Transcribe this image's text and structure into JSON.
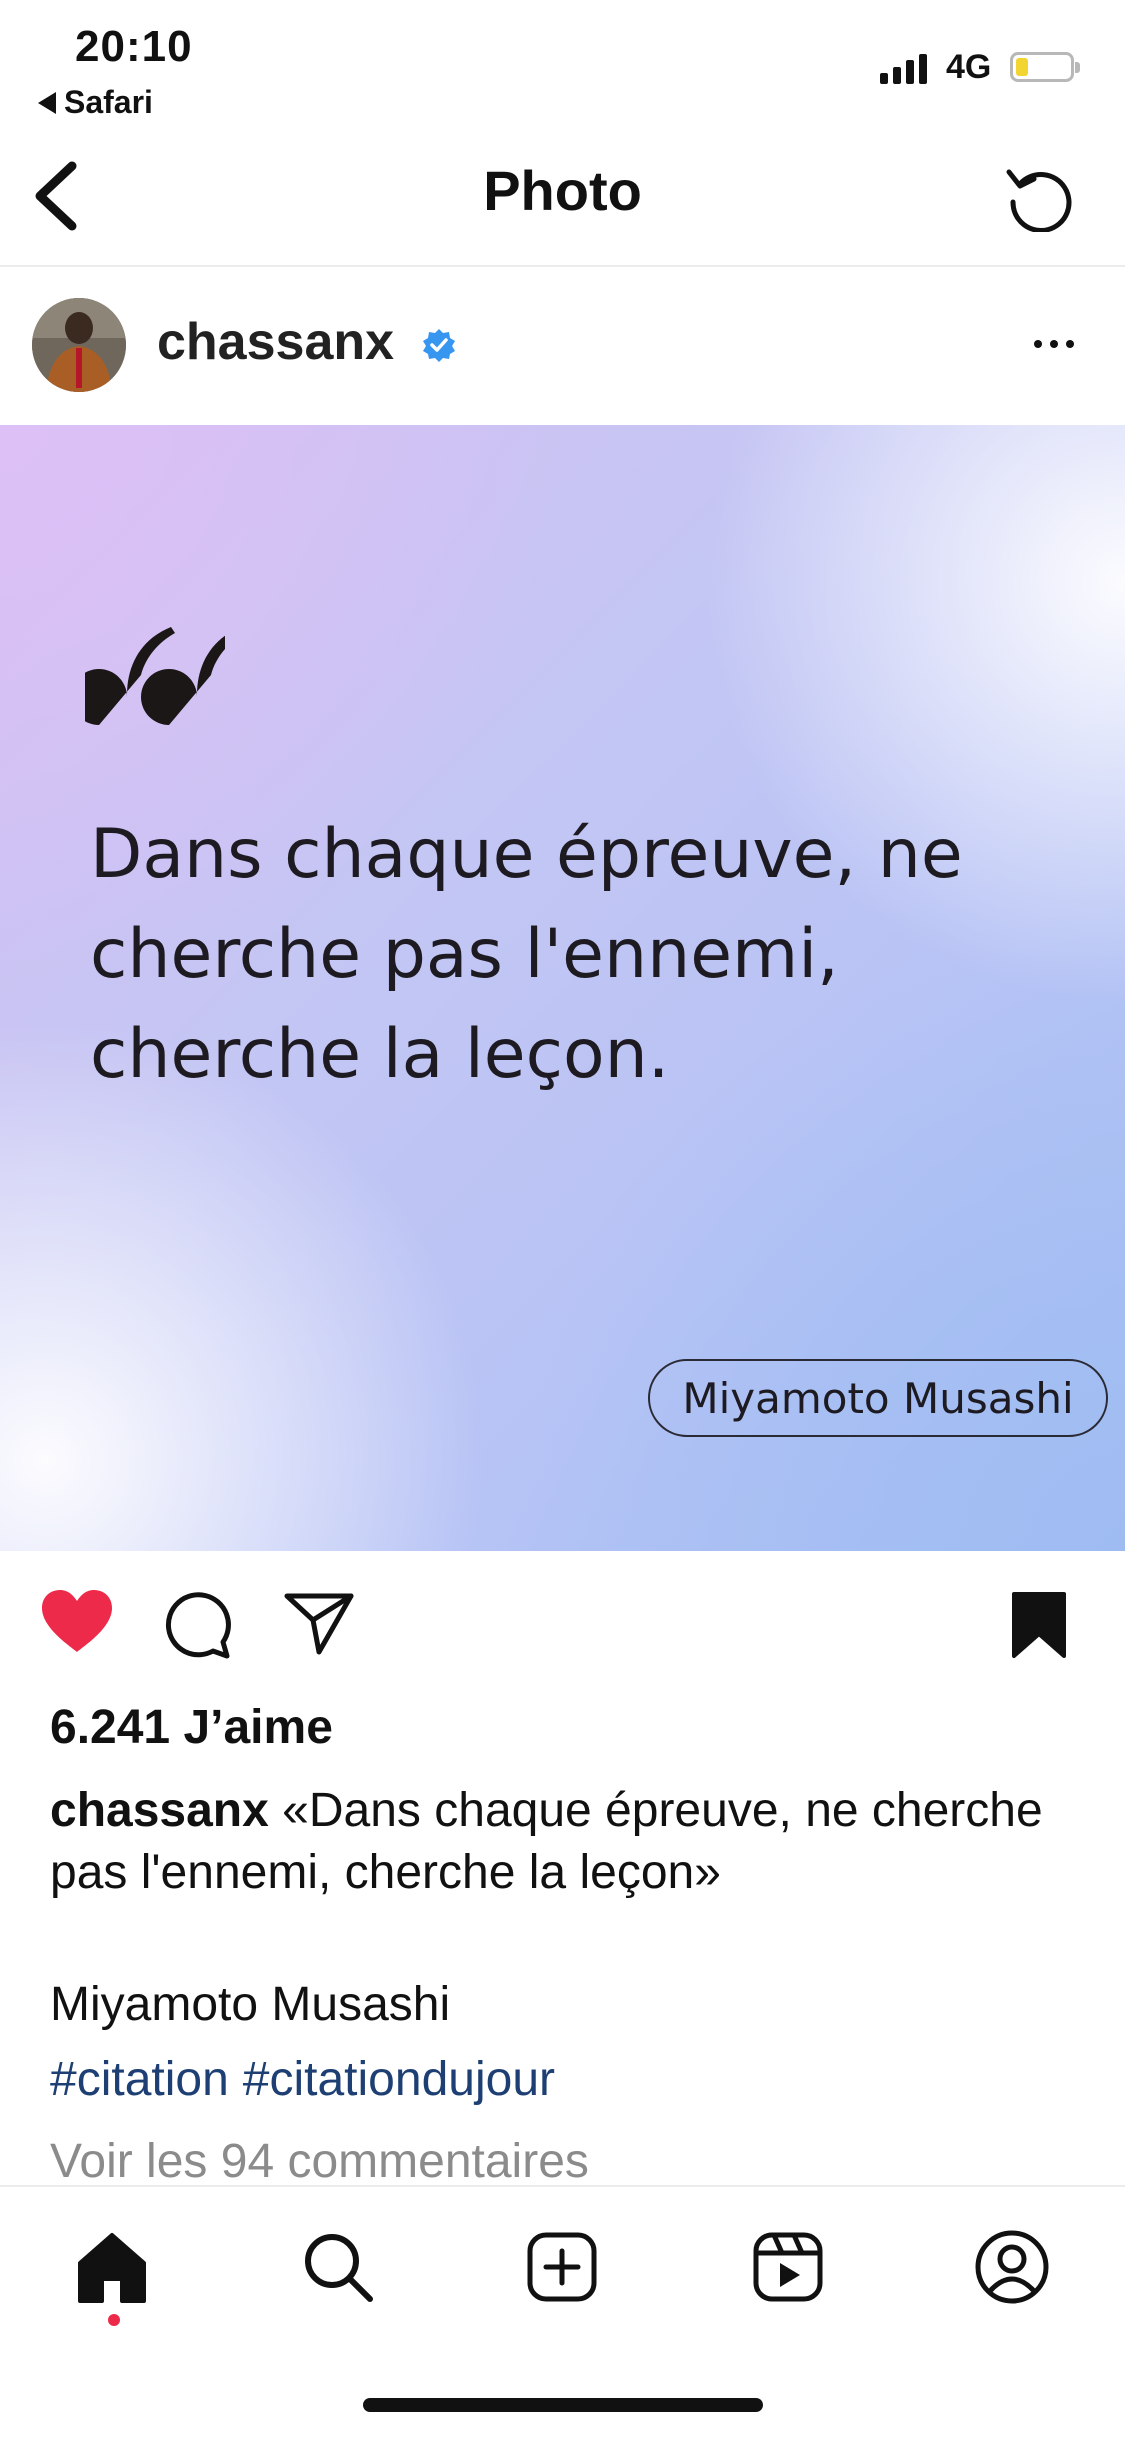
{
  "status_bar": {
    "time": "20:10",
    "back_app": "Safari",
    "network": "4G",
    "battery_level": 0.2,
    "signal_bars": 4
  },
  "nav": {
    "title": "Photo",
    "back_icon": "chevron-left-icon",
    "refresh_icon": "refresh-icon"
  },
  "post": {
    "username": "chassanx",
    "verified": true,
    "image": {
      "quote": "Dans chaque épreuve, ne cherche pas l'ennemi, cherche la leçon.",
      "author": "Miyamoto Musashi"
    },
    "liked": true,
    "saved": true,
    "likes_text": "6.241 J’aime",
    "caption_username": "chassanx",
    "caption_text": "«Dans chaque épreuve, ne cherche pas l'ennemi, cherche la leçon»",
    "caption_author": "Miyamoto Musashi",
    "hashtags": [
      "#citation",
      "#citationdujour"
    ],
    "view_comments": "Voir les 94 commentaires"
  },
  "tabbar": {
    "items": [
      "home-icon",
      "search-icon",
      "create-icon",
      "reels-icon",
      "profile-icon"
    ],
    "active": "home"
  },
  "colors": {
    "like": "#ee2a4a",
    "verified": "#3797f0",
    "hashtag": "#1d3f73",
    "muted": "#8b8b8b"
  }
}
